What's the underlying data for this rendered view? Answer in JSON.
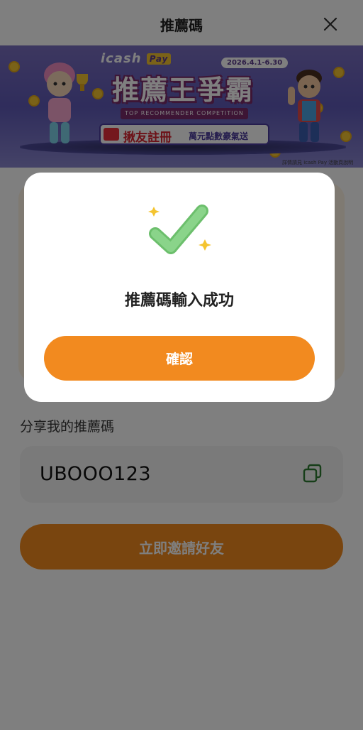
{
  "header": {
    "title": "推薦碼"
  },
  "banner": {
    "logo_text": "icash",
    "logo_pay": "Pay",
    "date_range": "2026.4.1-6.30",
    "title": "推薦王爭霸",
    "subtitle": "TOP RECOMMENDER COMPETITION",
    "tag_main": "揪友註冊",
    "tag_sub": "萬元點數豪氣送",
    "note": "詳情請見 icash Pay 活動頁說明",
    "accent_color": "#5f5ab8"
  },
  "share": {
    "label": "分享我的推薦碼",
    "code": "UBOOO123",
    "copy_icon": "copy-icon"
  },
  "invite_button": {
    "label": "立即邀請好友"
  },
  "modal": {
    "icon": "check-icon",
    "message": "推薦碼輸入成功",
    "confirm_label": "確認"
  },
  "colors": {
    "primary": "#f28a1f",
    "check_green": "#8ad48a",
    "sparkle": "#f4c430",
    "copy_icon": "#2e7d32"
  }
}
